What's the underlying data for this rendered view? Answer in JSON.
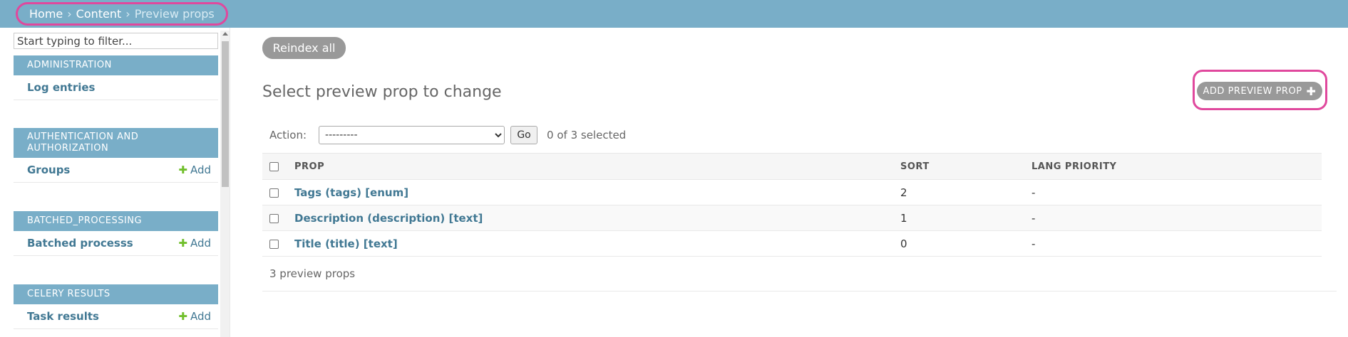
{
  "breadcrumbs": {
    "home": "Home",
    "separator1": "›",
    "content": "Content",
    "separator2": "›",
    "current": "Preview props"
  },
  "sidebar": {
    "filter_placeholder": "Start typing to filter...",
    "modules": [
      {
        "title": "ADMINISTRATION",
        "items": [
          {
            "label": "Log entries",
            "add": ""
          }
        ]
      },
      {
        "title": "AUTHENTICATION AND AUTHORIZATION",
        "items": [
          {
            "label": "Groups",
            "add": "Add"
          }
        ]
      },
      {
        "title": "BATCHED_PROCESSING",
        "items": [
          {
            "label": "Batched processs",
            "add": "Add"
          }
        ]
      },
      {
        "title": "CELERY RESULTS",
        "items": [
          {
            "label": "Task results",
            "add": "Add"
          }
        ]
      }
    ]
  },
  "main": {
    "reindex_label": "Reindex all",
    "title": "Select preview prop to change",
    "add_label": "ADD PREVIEW PROP",
    "actions": {
      "label": "Action:",
      "selected_option": "---------",
      "go_label": "Go",
      "selected_count": "0 of 3 selected"
    },
    "table": {
      "headers": [
        "PROP",
        "SORT",
        "LANG PRIORITY"
      ],
      "rows": [
        {
          "prop": "Tags (tags) [enum]",
          "sort": "2",
          "lang_priority": "-"
        },
        {
          "prop": "Description (description) [text]",
          "sort": "1",
          "lang_priority": "-"
        },
        {
          "prop": "Title (title) [text]",
          "sort": "0",
          "lang_priority": "-"
        }
      ]
    },
    "paginator": "3 preview props"
  },
  "colors": {
    "header_bg": "#79aec8",
    "link": "#417893",
    "add_green": "#70bf2b",
    "highlight": "#e0489d",
    "button_gray": "#999999"
  }
}
